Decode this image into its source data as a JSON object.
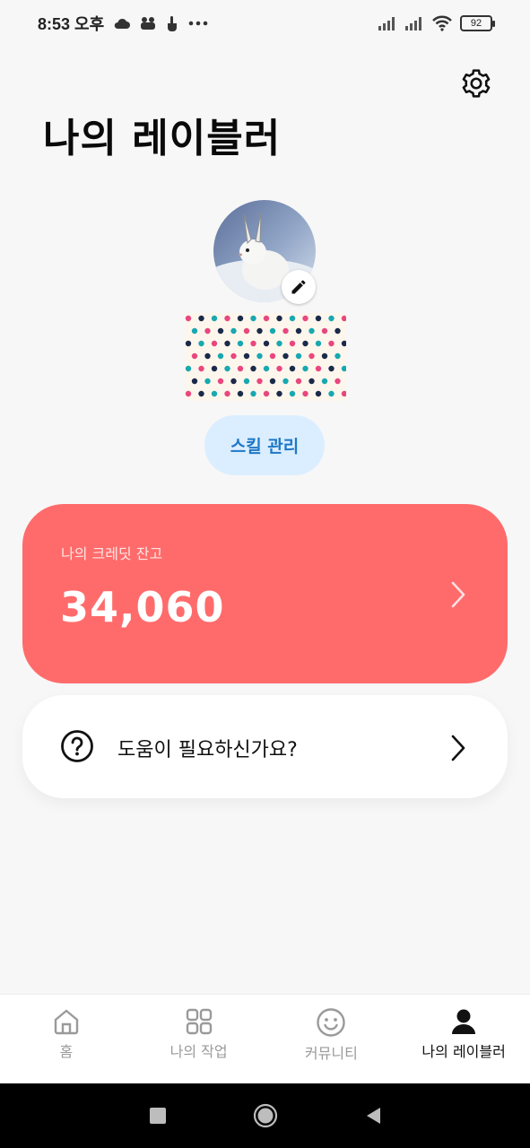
{
  "status_bar": {
    "time": "8:53 오후",
    "battery": "92"
  },
  "header": {
    "title": "나의 레이블러"
  },
  "profile": {
    "skill_button_label": "스킬 관리"
  },
  "credit": {
    "label": "나의 크레딧 잔고",
    "value": "34,060"
  },
  "help": {
    "label": "도움이 필요하신가요?"
  },
  "bottom_nav": {
    "items": [
      {
        "label": "홈",
        "icon": "home-icon",
        "active": false
      },
      {
        "label": "나의 작업",
        "icon": "grid-icon",
        "active": false
      },
      {
        "label": "커뮤니티",
        "icon": "smile-icon",
        "active": false
      },
      {
        "label": "나의 레이블러",
        "icon": "person-icon",
        "active": true
      }
    ]
  },
  "colors": {
    "accent_credit": "#ff6b6b",
    "skill_button_bg": "#dbeeff",
    "skill_button_text": "#1e78c8",
    "background": "#f7f7f7"
  }
}
